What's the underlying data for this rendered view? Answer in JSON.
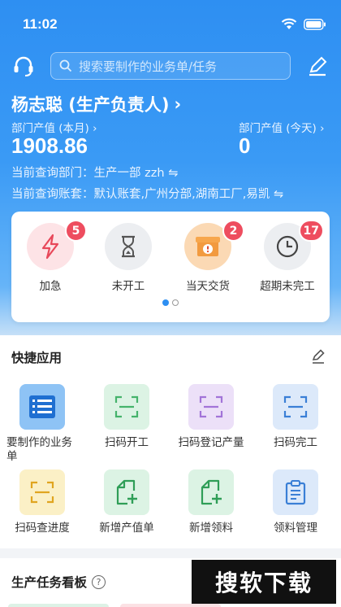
{
  "status_bar": {
    "time": "11:02"
  },
  "search": {
    "placeholder": "搜索要制作的业务单/任务"
  },
  "user": {
    "name": "杨志聪 (生产负责人)",
    "arrow": "›"
  },
  "stats": [
    {
      "label": "部门产值 (本月) ›",
      "value": "1908.86"
    },
    {
      "label": "部门产值 (今天) ›",
      "value": "0"
    }
  ],
  "info": {
    "department": "当前查询部门：生产一部 zzh ⇋",
    "accounts": "当前查询账套：默认账套,广州分部,湖南工厂,易凯 ⇋"
  },
  "quick_actions": [
    {
      "label": "加急",
      "badge": "5",
      "icon": "lightning-icon"
    },
    {
      "label": "未开工",
      "badge": "",
      "icon": "hourglass-icon"
    },
    {
      "label": "当天交货",
      "badge": "2",
      "icon": "box-alert-icon"
    },
    {
      "label": "超期未完工",
      "badge": "17",
      "icon": "clock-icon"
    }
  ],
  "pager": {
    "pages": 2,
    "active": 0
  },
  "apps_section": {
    "title": "快捷应用",
    "items": [
      {
        "label": "要制作的业务单",
        "icon": "list-icon"
      },
      {
        "label": "扫码开工",
        "icon": "scan-icon"
      },
      {
        "label": "扫码登记产量",
        "icon": "scan-icon"
      },
      {
        "label": "扫码完工",
        "icon": "scan-icon"
      },
      {
        "label": "扫码查进度",
        "icon": "scan-icon"
      },
      {
        "label": "新增产值单",
        "icon": "doc-add-icon"
      },
      {
        "label": "新增领料",
        "icon": "doc-add-icon"
      },
      {
        "label": "领料管理",
        "icon": "clipboard-icon"
      }
    ]
  },
  "board": {
    "title": "生产任务看板",
    "help": "?"
  },
  "watermark": {
    "text": "搜软下载"
  },
  "colors": {
    "primary": "#2e8ff2",
    "badge": "#ee4d5f",
    "urgent_bg": "#fde3e6",
    "urgent_fg": "#e8485a",
    "neutral_bg": "#eceef1",
    "delivery_bg": "#f7a64c",
    "green": "#45b36b",
    "purple": "#a274d8",
    "blue": "#3a7fd6",
    "yellow": "#e0a520"
  }
}
